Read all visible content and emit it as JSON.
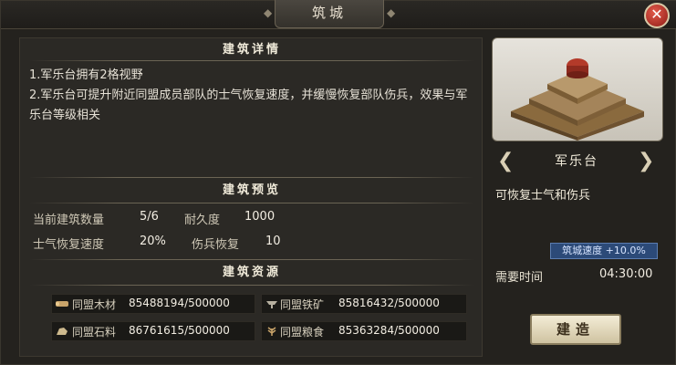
{
  "window": {
    "title": "筑城"
  },
  "details": {
    "title": "建筑详情",
    "line1": "1.军乐台拥有2格视野",
    "line2": "2.军乐台可提升附近同盟成员部队的士气恢复速度，并缓慢恢复部队伤兵，效果与军乐台等级相关"
  },
  "preview": {
    "title": "建筑预览",
    "stats": [
      {
        "label": "当前建筑数量",
        "value": "5/6"
      },
      {
        "label": "耐久度",
        "value": "1000"
      },
      {
        "label": "士气恢复速度",
        "value": "20%"
      },
      {
        "label": "伤兵恢复",
        "value": "10"
      }
    ]
  },
  "resources": {
    "title": "建筑资源",
    "items": [
      {
        "label": "同盟木材",
        "value": "85488194/500000",
        "icon": "wood-icon"
      },
      {
        "label": "同盟铁矿",
        "value": "85816432/500000",
        "icon": "iron-icon"
      },
      {
        "label": "同盟石料",
        "value": "86761615/500000",
        "icon": "stone-icon"
      },
      {
        "label": "同盟粮食",
        "value": "85363284/500000",
        "icon": "grain-icon"
      }
    ]
  },
  "building": {
    "name": "军乐台",
    "desc": "可恢复士气和伤兵",
    "speed_badge": "筑城速度 +10.0%",
    "time_label": "需要时间",
    "time_value": "04:30:00"
  },
  "actions": {
    "build_label": "建造",
    "close_label": "✕"
  },
  "colors": {
    "speed_badge": "#2c4a78",
    "close": "#8f1c16"
  }
}
